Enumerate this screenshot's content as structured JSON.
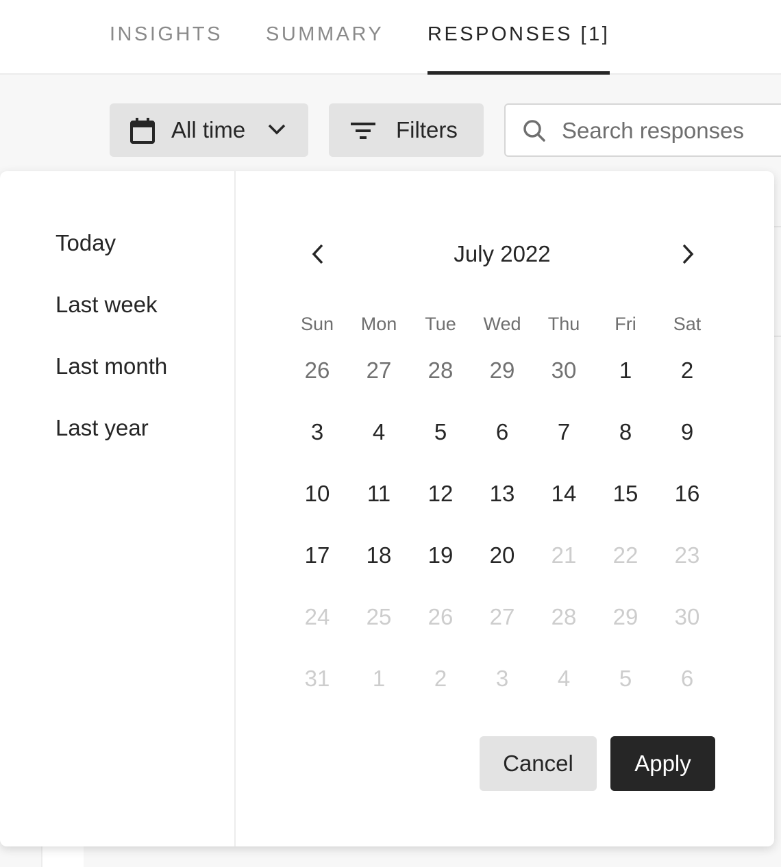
{
  "tabs": [
    {
      "label": "INSIGHTS",
      "active": false
    },
    {
      "label": "SUMMARY",
      "active": false
    },
    {
      "label": "RESPONSES [1]",
      "active": true
    }
  ],
  "toolbar": {
    "date_range_label": "All time",
    "filters_label": "Filters",
    "search_placeholder": "Search responses"
  },
  "presets": [
    "Today",
    "Last week",
    "Last month",
    "Last year"
  ],
  "calendar": {
    "month_label": "July 2022",
    "weekdays": [
      "Sun",
      "Mon",
      "Tue",
      "Wed",
      "Thu",
      "Fri",
      "Sat"
    ],
    "weeks": [
      [
        {
          "d": "26",
          "s": "muted"
        },
        {
          "d": "27",
          "s": "muted"
        },
        {
          "d": "28",
          "s": "muted"
        },
        {
          "d": "29",
          "s": "muted"
        },
        {
          "d": "30",
          "s": "muted"
        },
        {
          "d": "1",
          "s": "current"
        },
        {
          "d": "2",
          "s": "current"
        }
      ],
      [
        {
          "d": "3",
          "s": "current"
        },
        {
          "d": "4",
          "s": "current"
        },
        {
          "d": "5",
          "s": "current"
        },
        {
          "d": "6",
          "s": "current"
        },
        {
          "d": "7",
          "s": "current"
        },
        {
          "d": "8",
          "s": "current"
        },
        {
          "d": "9",
          "s": "current"
        }
      ],
      [
        {
          "d": "10",
          "s": "current"
        },
        {
          "d": "11",
          "s": "current"
        },
        {
          "d": "12",
          "s": "current"
        },
        {
          "d": "13",
          "s": "current"
        },
        {
          "d": "14",
          "s": "current"
        },
        {
          "d": "15",
          "s": "current"
        },
        {
          "d": "16",
          "s": "current"
        }
      ],
      [
        {
          "d": "17",
          "s": "current"
        },
        {
          "d": "18",
          "s": "current"
        },
        {
          "d": "19",
          "s": "current"
        },
        {
          "d": "20",
          "s": "current"
        },
        {
          "d": "21",
          "s": "disabled"
        },
        {
          "d": "22",
          "s": "disabled"
        },
        {
          "d": "23",
          "s": "disabled"
        }
      ],
      [
        {
          "d": "24",
          "s": "disabled"
        },
        {
          "d": "25",
          "s": "disabled"
        },
        {
          "d": "26",
          "s": "disabled"
        },
        {
          "d": "27",
          "s": "disabled"
        },
        {
          "d": "28",
          "s": "disabled"
        },
        {
          "d": "29",
          "s": "disabled"
        },
        {
          "d": "30",
          "s": "disabled"
        }
      ],
      [
        {
          "d": "31",
          "s": "disabled"
        },
        {
          "d": "1",
          "s": "disabled"
        },
        {
          "d": "2",
          "s": "disabled"
        },
        {
          "d": "3",
          "s": "disabled"
        },
        {
          "d": "4",
          "s": "disabled"
        },
        {
          "d": "5",
          "s": "disabled"
        },
        {
          "d": "6",
          "s": "disabled"
        }
      ]
    ]
  },
  "actions": {
    "cancel_label": "Cancel",
    "apply_label": "Apply"
  },
  "colors": {
    "accent": "#262626",
    "secondary_button": "#e3e3e3",
    "disabled_text": "#cdcdcd"
  }
}
